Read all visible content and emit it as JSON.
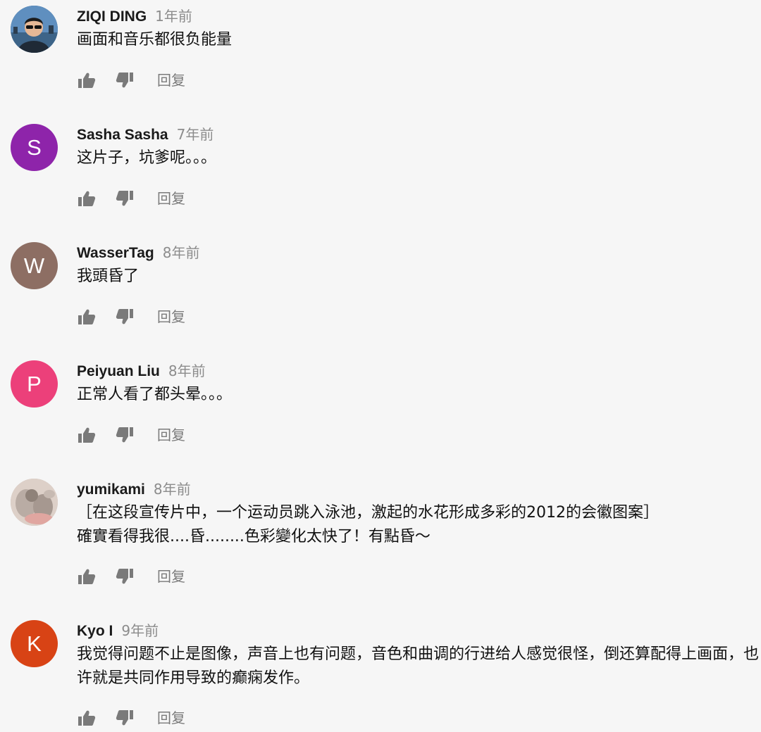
{
  "reply_label": "回复",
  "comments": [
    {
      "author": "ZIQI DING",
      "time": "1年前",
      "text": "画面和音乐都很负能量",
      "avatar": {
        "type": "photo",
        "icon": "person-with-sunglasses-avatar",
        "color": "#2f5f8f"
      }
    },
    {
      "author": "Sasha Sasha",
      "time": "7年前",
      "text": "这片子，坑爹呢。。。",
      "avatar": {
        "type": "letter",
        "letter": "S",
        "color": "#8e24aa"
      }
    },
    {
      "author": "WasserTag",
      "time": "8年前",
      "text": "我頭昏了",
      "avatar": {
        "type": "letter",
        "letter": "W",
        "color": "#8d6e63"
      }
    },
    {
      "author": "Peiyuan Liu",
      "time": "8年前",
      "text": "正常人看了都头晕。。。",
      "avatar": {
        "type": "letter",
        "letter": "P",
        "color": "#ec407a"
      }
    },
    {
      "author": "yumikami",
      "time": "8年前",
      "text": "［在这段宣传片中，一个运动员跳入泳池，激起的水花形成多彩的2012的会徽图案］\n確實看得我很....昏........色彩變化太快了！有點昏～",
      "avatar": {
        "type": "photo",
        "icon": "cat-photo-avatar",
        "color": "#c9b8b0"
      }
    },
    {
      "author": "Kyo I",
      "time": "9年前",
      "text": "我觉得问题不止是图像，声音上也有问题，音色和曲调的行进给人感觉很怪，倒还算配得上画面，也许就是共同作用导致的癫痫发作。",
      "avatar": {
        "type": "letter",
        "letter": "K",
        "color": "#d84315"
      }
    }
  ]
}
